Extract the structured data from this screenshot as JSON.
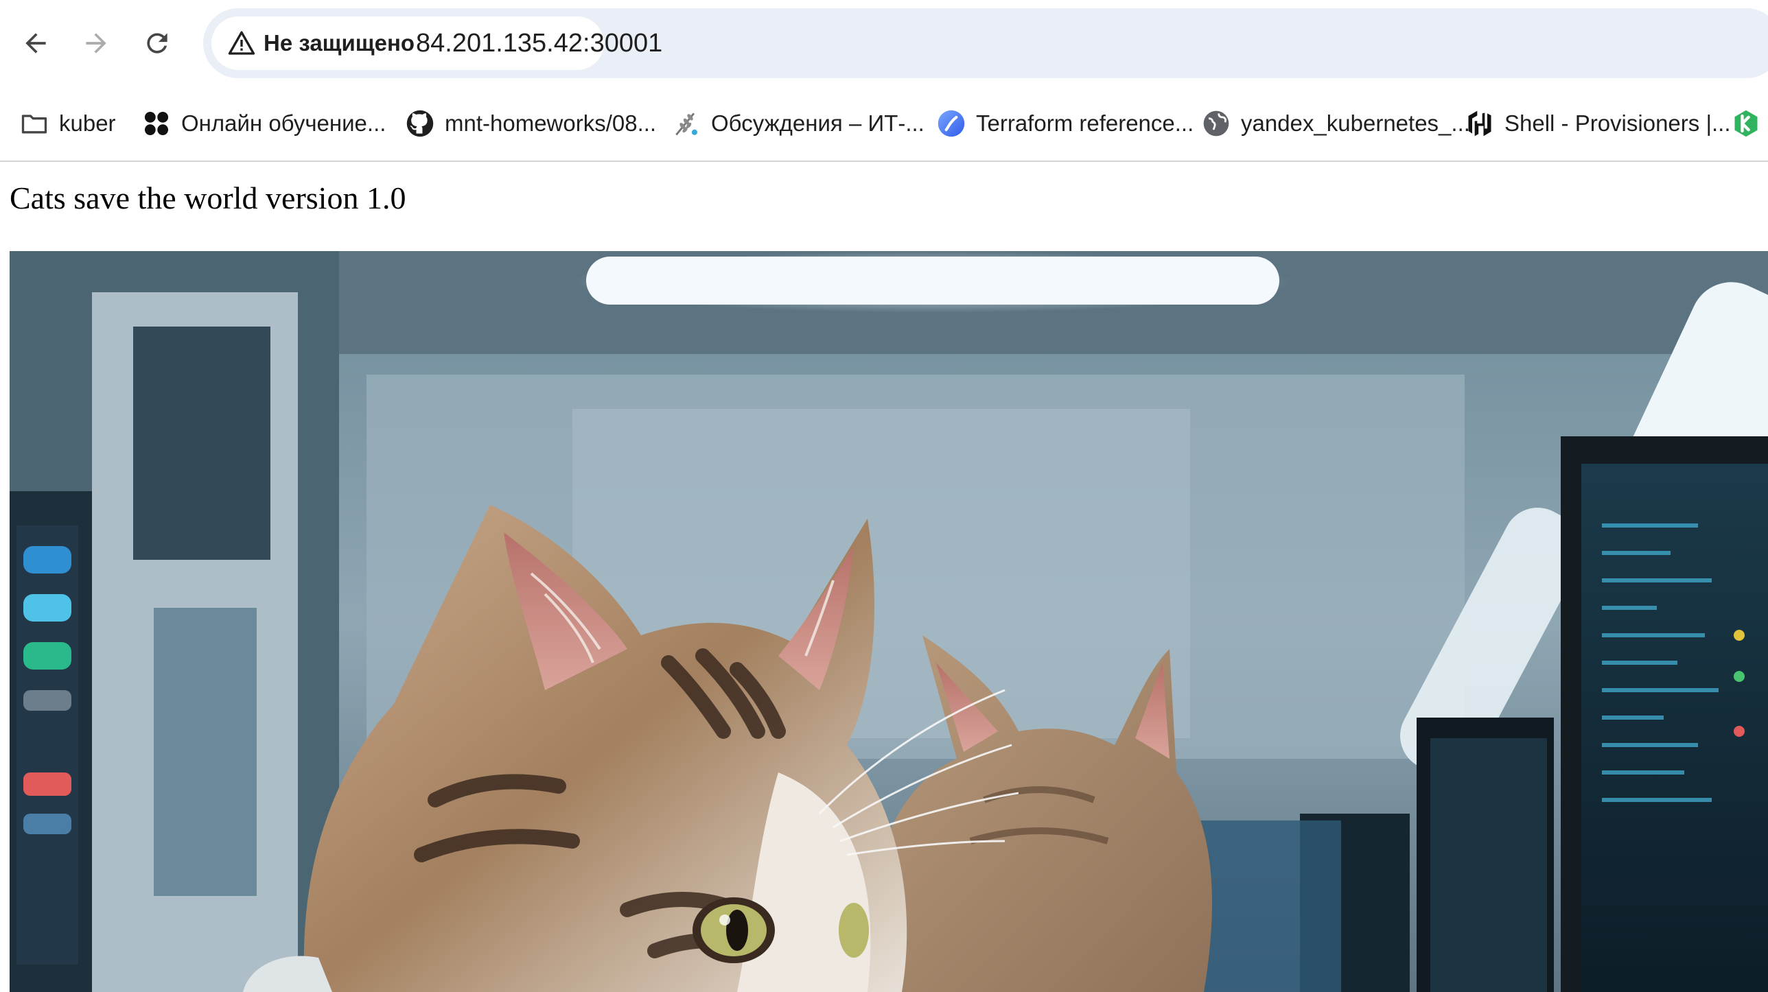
{
  "browser": {
    "security_label": "Не защищено",
    "url": "84.201.135.42:30001",
    "nav": {
      "back_icon": "arrow-left-icon",
      "forward_icon": "arrow-right-icon",
      "reload_icon": "reload-icon"
    }
  },
  "bookmarks": [
    {
      "label": "kuber",
      "icon": "folder-icon"
    },
    {
      "label": "Онлайн обучение...",
      "icon": "four-dots-logo-icon"
    },
    {
      "label": "mnt-homeworks/08...",
      "icon": "github-icon"
    },
    {
      "label": "Обсуждения – ИТ-...",
      "icon": "wheat-logo-icon"
    },
    {
      "label": "Terraform reference...",
      "icon": "terraform-docs-icon"
    },
    {
      "label": "yandex_kubernetes_...",
      "icon": "globe-icon"
    },
    {
      "label": "Shell - Provisioners |...",
      "icon": "hashicorp-icon"
    },
    {
      "label": "",
      "icon": "kubernetes-green-icon"
    }
  ],
  "page": {
    "title": "Cats save the world version 1.0",
    "image_subject": "tabby kittens in a server room with monitors"
  },
  "colors": {
    "omnibox_bg": "#e9eef7",
    "toolbar_bg": "#ffffff",
    "text": "#1f1f1f"
  }
}
